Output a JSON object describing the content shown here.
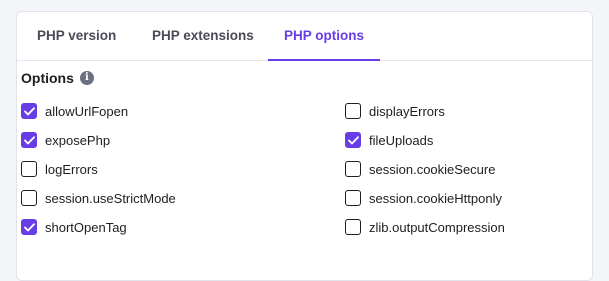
{
  "tabs": [
    {
      "label": "PHP version",
      "active": false
    },
    {
      "label": "PHP extensions",
      "active": false
    },
    {
      "label": "PHP options",
      "active": true
    }
  ],
  "options": {
    "heading": "Options",
    "info_icon": "info-icon",
    "left": [
      {
        "label": "allowUrlFopen",
        "checked": true
      },
      {
        "label": "exposePhp",
        "checked": true
      },
      {
        "label": "logErrors",
        "checked": false
      },
      {
        "label": "session.useStrictMode",
        "checked": false
      },
      {
        "label": "shortOpenTag",
        "checked": true
      }
    ],
    "right": [
      {
        "label": "displayErrors",
        "checked": false
      },
      {
        "label": "fileUploads",
        "checked": true
      },
      {
        "label": "session.cookieSecure",
        "checked": false
      },
      {
        "label": "session.cookieHttponly",
        "checked": false
      },
      {
        "label": "zlib.outputCompression",
        "checked": false
      }
    ]
  },
  "colors": {
    "accent": "#673de6",
    "text": "#1d1e20"
  }
}
